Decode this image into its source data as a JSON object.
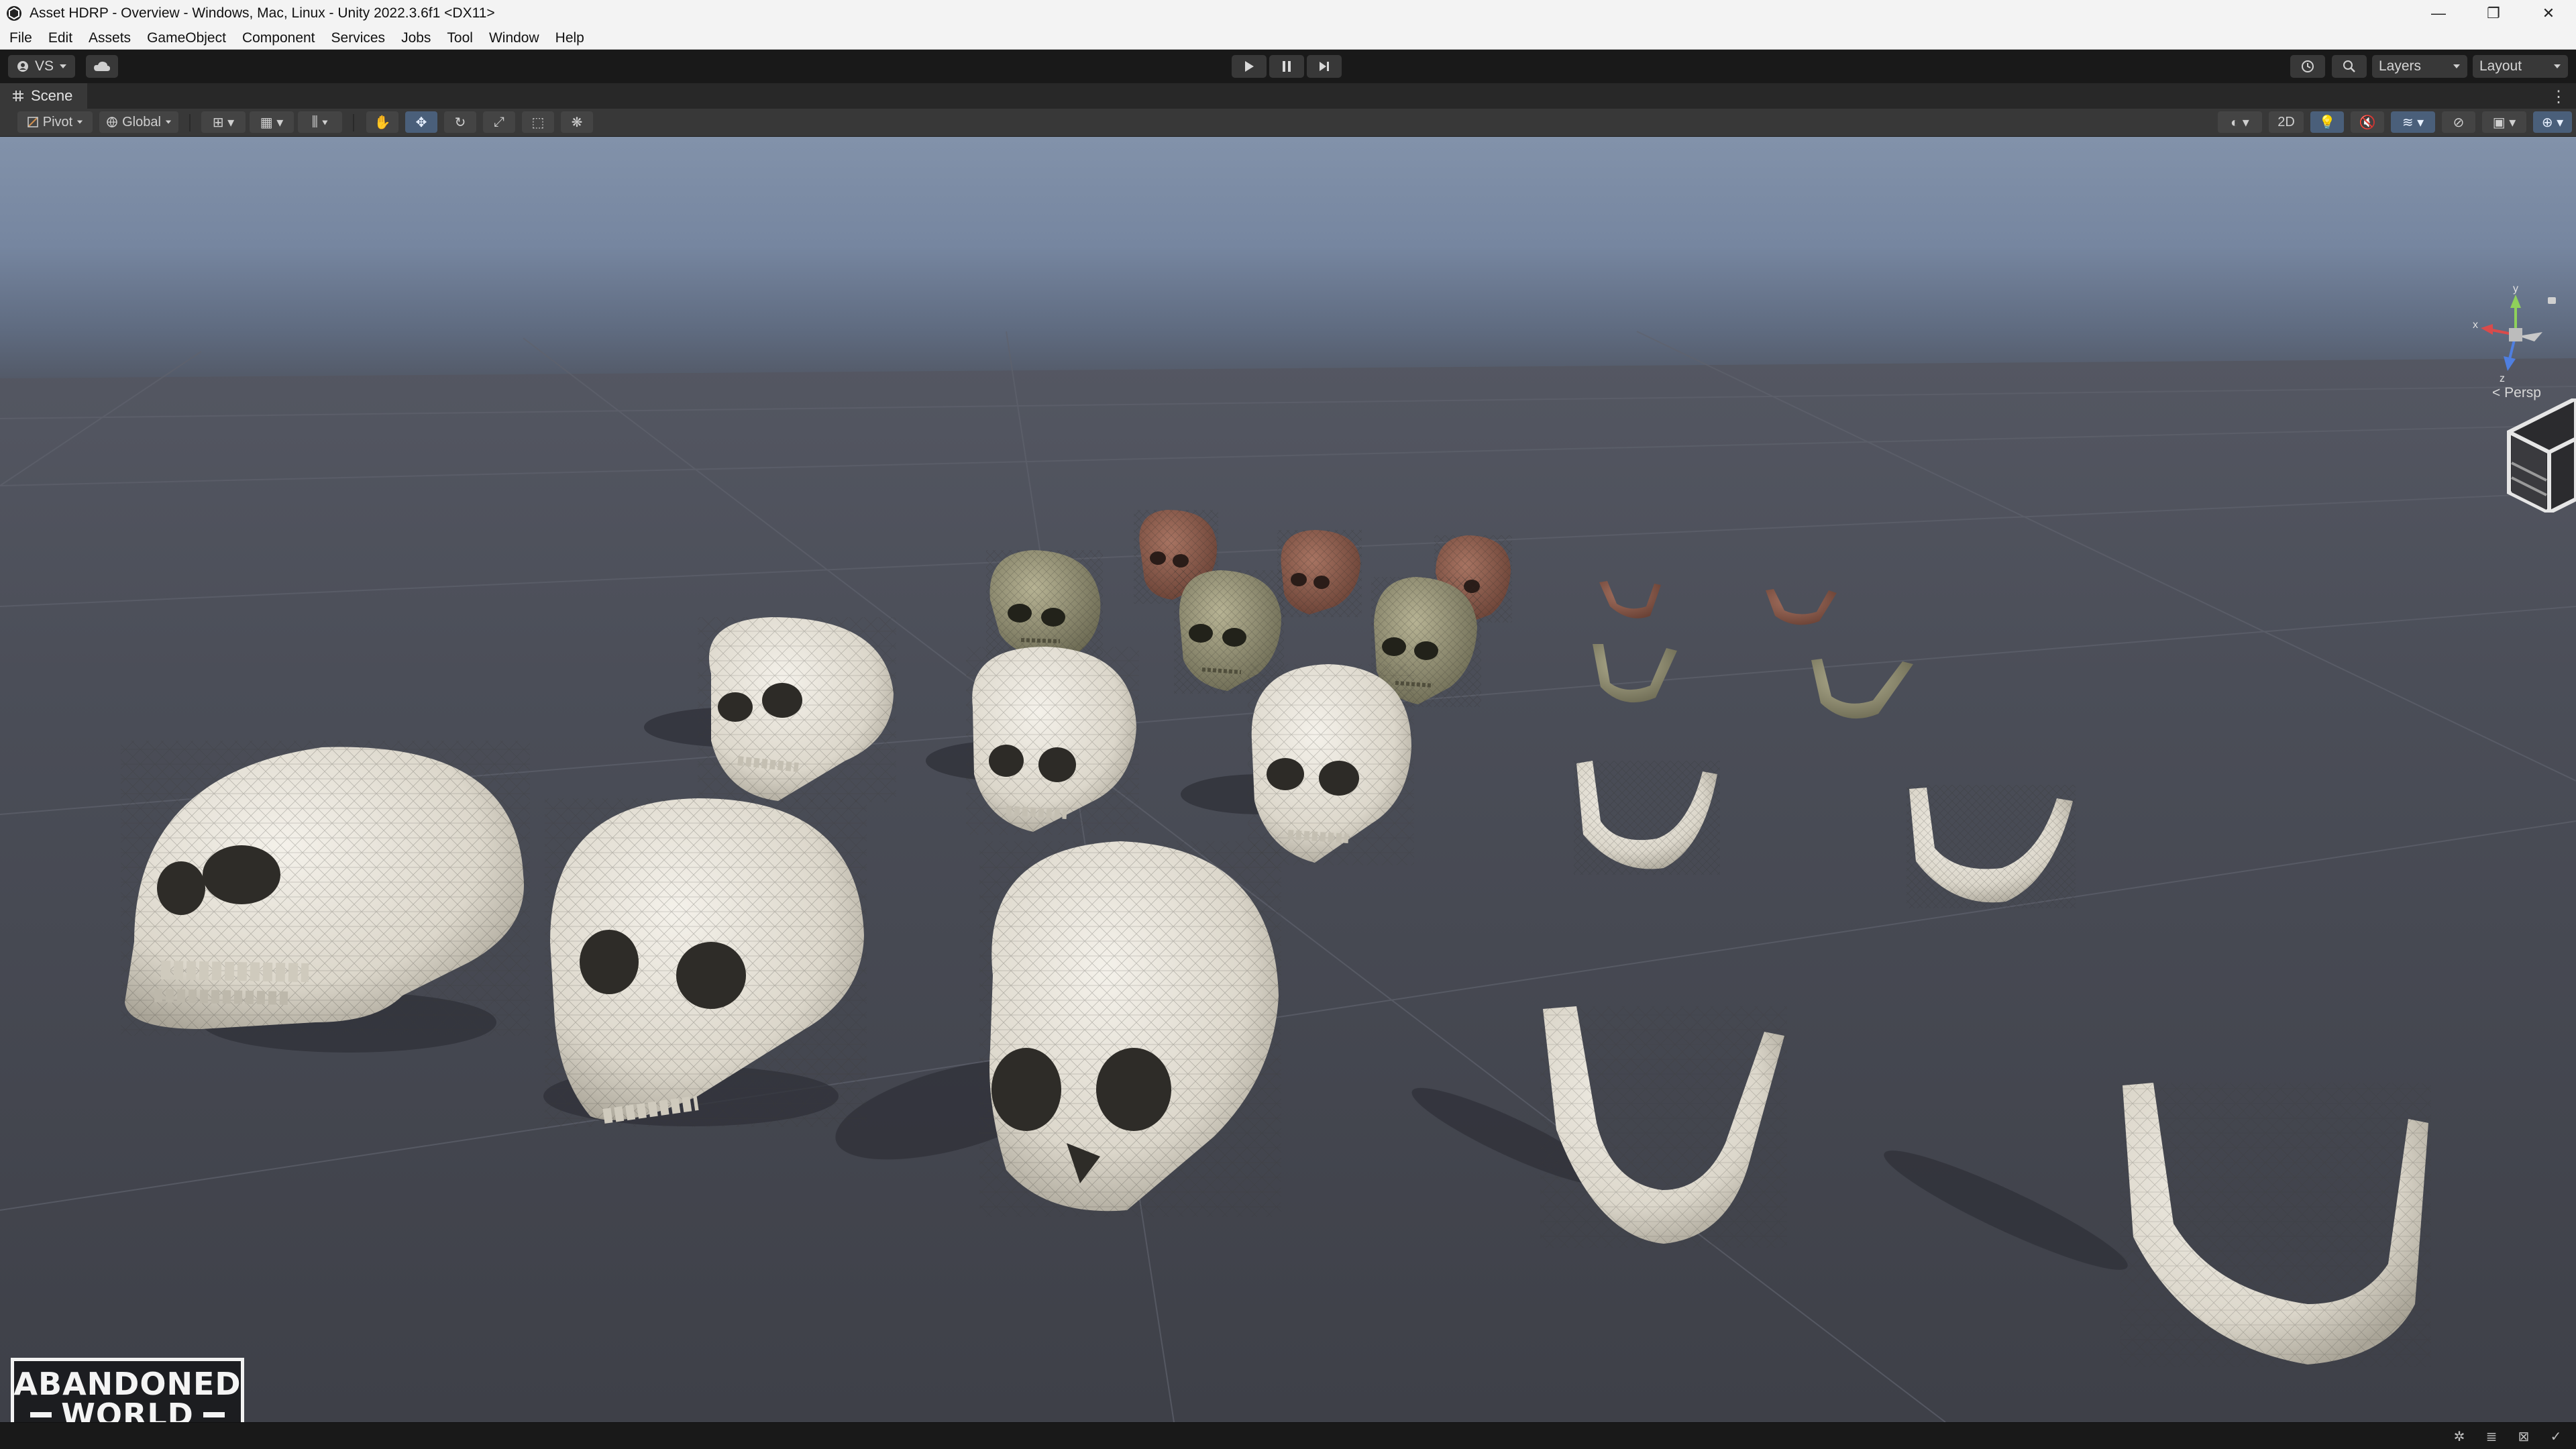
{
  "window": {
    "title": "Asset HDRP - Overview - Windows, Mac, Linux - Unity 2022.3.6f1 <DX11>",
    "minimize": "—",
    "restore": "❐",
    "close": "✕"
  },
  "menu": [
    "File",
    "Edit",
    "Assets",
    "GameObject",
    "Component",
    "Services",
    "Jobs",
    "Tool",
    "Window",
    "Help"
  ],
  "toolbar": {
    "account_label": "VS",
    "layers_label": "Layers",
    "layout_label": "Layout"
  },
  "scene_tab": {
    "label": "Scene"
  },
  "scene_toolbar": {
    "pivot_label": "Pivot",
    "global_label": "Global",
    "mode_2d_label": "2D"
  },
  "gizmo": {
    "y_label": "y",
    "x_label": "x",
    "z_label": "z",
    "persp_label": "< Persp"
  },
  "watermark": {
    "line1": "ABANDONED",
    "line2": "WORLD"
  },
  "colors": {
    "sky_top": "#8292aa",
    "floor": "#4a4c56",
    "skull_white": "#e8e4da",
    "skull_green": "#9b987a",
    "skull_red": "#8a5a4a",
    "accent_blue": "#4a5f7a"
  }
}
